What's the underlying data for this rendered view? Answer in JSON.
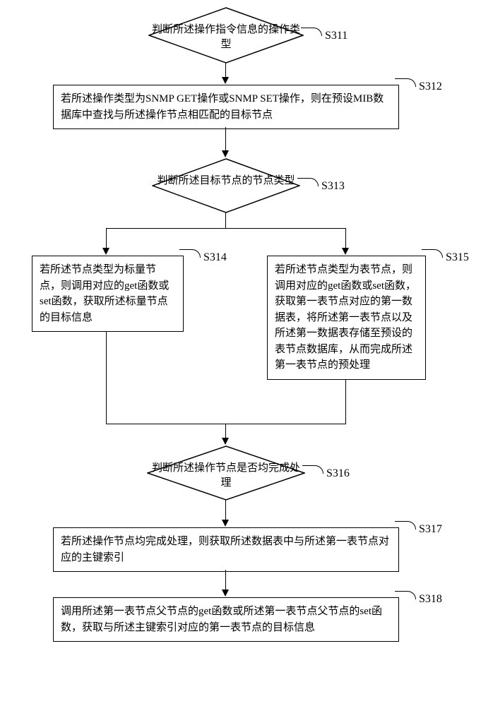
{
  "steps": {
    "s311": {
      "text": "判断所述操作指令信息的操作类型",
      "label": "S311"
    },
    "s312": {
      "text": "若所述操作类型为SNMP GET操作或SNMP SET操作，则在预设MIB数据库中查找与所述操作节点相匹配的目标节点",
      "label": "S312"
    },
    "s313": {
      "text": "判断所述目标节点的节点类型",
      "label": "S313"
    },
    "s314": {
      "text": "若所述节点类型为标量节点，则调用对应的get函数或set函数，获取所述标量节点的目标信息",
      "label": "S314"
    },
    "s315": {
      "text": "若所述节点类型为表节点，则调用对应的get函数或set函数，获取第一表节点对应的第一数据表，将所述第一表节点以及所述第一数据表存储至预设的表节点数据库，从而完成所述第一表节点的预处理",
      "label": "S315"
    },
    "s316": {
      "text": "判断所述操作节点是否均完成处理",
      "label": "S316"
    },
    "s317": {
      "text": "若所述操作节点均完成处理，则获取所述数据表中与所述第一表节点对应的主键索引",
      "label": "S317"
    },
    "s318": {
      "text": "调用所述第一表节点父节点的get函数或所述第一表节点父节点的set函数，获取与所述主键索引对应的第一表节点的目标信息",
      "label": "S318"
    }
  }
}
